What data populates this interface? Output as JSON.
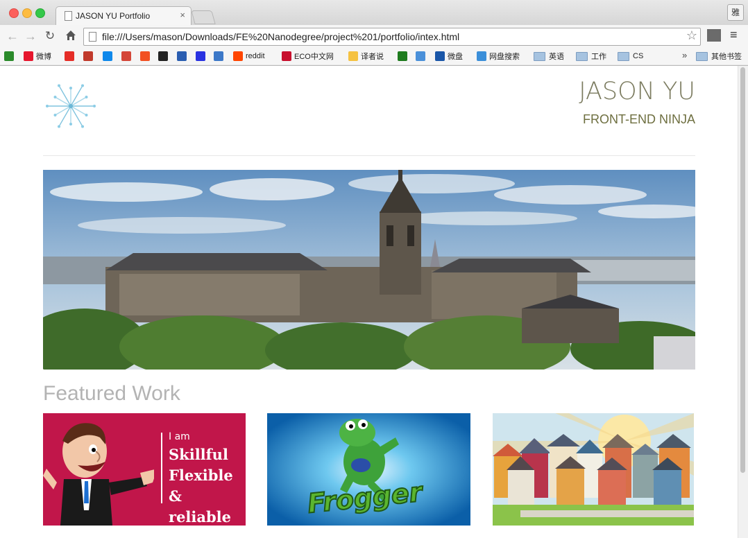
{
  "browser": {
    "tab_title": "JASON YU Portfolio",
    "tab_close": "×",
    "profile_label": "雅",
    "url": "file:///Users/mason/Downloads/FE%20Nanodegree/project%201/portfolio/intex.html",
    "bookmarks": [
      {
        "label": "",
        "icon": "green-square-icon",
        "color": "#2a8a2a"
      },
      {
        "label": "微博",
        "icon": "weibo-icon",
        "color": "#e6162d"
      },
      {
        "label": "",
        "icon": "youtube-icon",
        "color": "#e52d27"
      },
      {
        "label": "",
        "icon": "q-icon",
        "color": "#c0392b"
      },
      {
        "label": "",
        "icon": "zhihu-icon",
        "color": "#0f88eb"
      },
      {
        "label": "",
        "icon": "gmail-icon",
        "color": "#d44638"
      },
      {
        "label": "",
        "icon": "windows-icon",
        "color": "#f25022"
      },
      {
        "label": "",
        "icon": "nytimes-icon",
        "color": "#222222"
      },
      {
        "label": "",
        "icon": "lock-icon",
        "color": "#2a5db0"
      },
      {
        "label": "",
        "icon": "paw-icon",
        "color": "#2932e1"
      },
      {
        "label": "",
        "icon": "cd-icon",
        "color": "#3c78c8"
      },
      {
        "label": "reddit",
        "icon": "reddit-icon",
        "color": "#ff4500"
      },
      {
        "label": "ECO中文网",
        "icon": "eco-icon",
        "color": "#c8102e"
      },
      {
        "label": "译者说",
        "icon": "translator-icon",
        "color": "#f5c242"
      },
      {
        "label": "",
        "icon": "w-icon",
        "color": "#1e7b1e"
      },
      {
        "label": "",
        "icon": "gc-icon",
        "color": "#4a90d9"
      },
      {
        "label": "微盘",
        "icon": "vdisk-icon",
        "color": "#1a56a8"
      },
      {
        "label": "网盘搜索",
        "icon": "cloud-search-icon",
        "color": "#3b8fd9"
      },
      {
        "label": "英语",
        "icon": "folder-icon",
        "color": "#a6c3e0"
      },
      {
        "label": "工作",
        "icon": "folder-icon",
        "color": "#a6c3e0"
      },
      {
        "label": "CS",
        "icon": "folder-icon",
        "color": "#a6c3e0"
      }
    ],
    "more": "»",
    "other_bookmarks": "其他书签"
  },
  "site": {
    "name": "JASON YU",
    "tagline": "FRONT-END NINJA",
    "logo_icon": "snowflake-icon",
    "hero_alt": "University campus panorama",
    "section_title": "Featured Work",
    "projects": [
      {
        "line0": "I am",
        "line1": "Skillful",
        "line2": "Flexible",
        "line3": "& reliable"
      },
      {
        "title": "Frogger"
      },
      {
        "icon": "houses-illustration"
      }
    ]
  }
}
